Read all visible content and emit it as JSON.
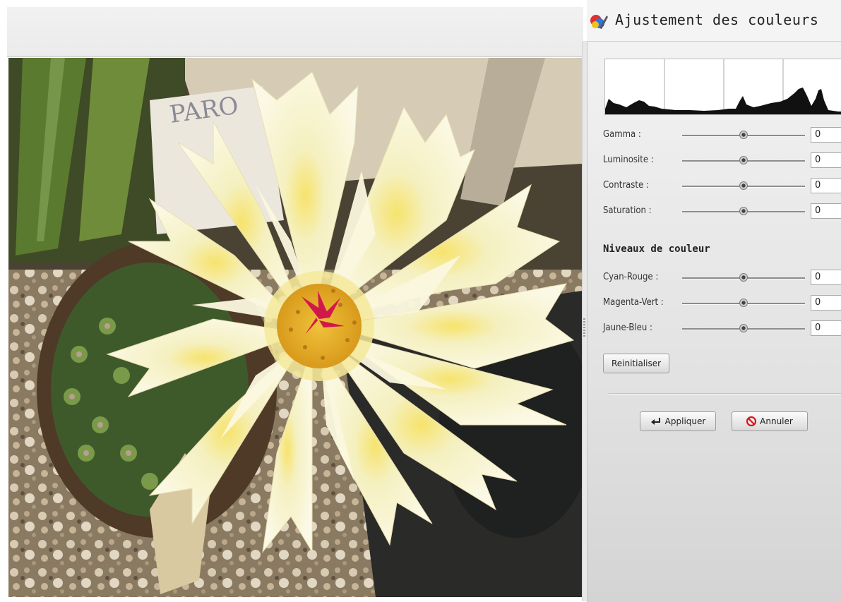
{
  "panel": {
    "title": "Ajustement des couleurs",
    "app_icon": "color-adjust-icon"
  },
  "photo": {
    "tag_text": "PARO"
  },
  "adjustments": [
    {
      "label": "Gamma :",
      "value": "0",
      "position": 0.5
    },
    {
      "label": "Luminosite :",
      "value": "0",
      "position": 0.5
    },
    {
      "label": "Contraste :",
      "value": "0",
      "position": 0.5
    },
    {
      "label": "Saturation :",
      "value": "0",
      "position": 0.5
    }
  ],
  "color_levels": {
    "title": "Niveaux de couleur",
    "items": [
      {
        "label": "Cyan-Rouge :",
        "value": "0",
        "position": 0.5
      },
      {
        "label": "Magenta-Vert :",
        "value": "0",
        "position": 0.5
      },
      {
        "label": "Jaune-Bleu :",
        "value": "0",
        "position": 0.5
      }
    ]
  },
  "buttons": {
    "reset": "Reinitialiser",
    "apply": "Appliquer",
    "cancel": "Annuler"
  },
  "icons": {
    "apply": "return-arrow-icon",
    "cancel": "no-entry-icon"
  },
  "colors": {
    "cancel_icon": "#d8141a",
    "flower": "#f4efc0",
    "flower_center": "#e8b82c",
    "stigma": "#d0184c"
  }
}
